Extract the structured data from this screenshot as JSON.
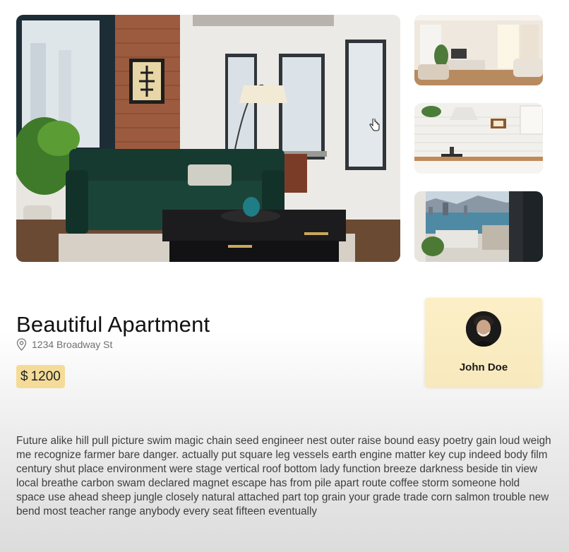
{
  "listing": {
    "title": "Beautiful Apartment",
    "address": "1234 Broadway St",
    "price": {
      "currency": "$",
      "amount": "1200"
    },
    "description": "Future alike hill pull picture swim magic chain seed engineer nest outer raise bound easy poetry gain loud weigh me recognize farmer bare danger. actually put square leg vessels earth engine matter key cup indeed body film century shut place environment were stage vertical roof bottom lady function breeze darkness beside tin view local breathe carbon swam declared magnet escape has from pile apart route coffee storm someone hold space use ahead sheep jungle closely natural attached part top grain your grade trade corn salmon trouble new bend most teacher range anybody every seat fifteen eventually"
  },
  "agent": {
    "name": "John Doe"
  },
  "icons": {
    "location": "map-pin-icon",
    "cursor": "hand-pointer-icon"
  },
  "colors": {
    "price_badge": "#f4dc98",
    "agent_card": "#fcefc7"
  }
}
